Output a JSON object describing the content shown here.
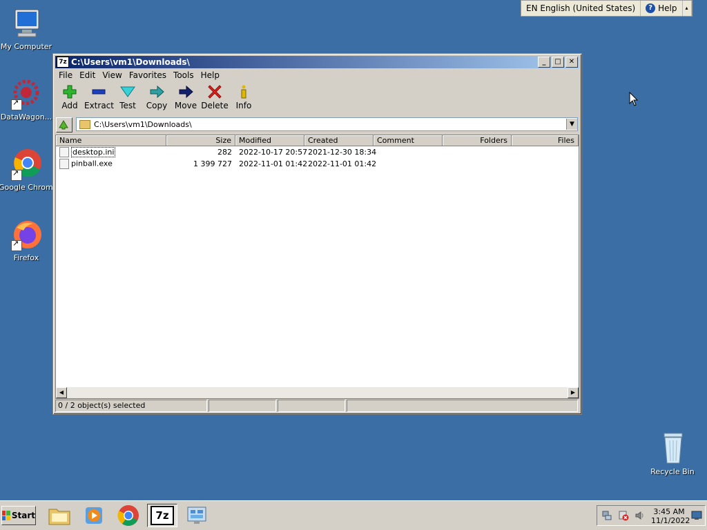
{
  "desktop": {
    "icons": [
      {
        "label": "My Computer"
      },
      {
        "label": "DataWagon..."
      },
      {
        "label": "Google Chrome"
      },
      {
        "label": "Firefox"
      }
    ],
    "recycle_bin": {
      "label": "Recycle Bin"
    }
  },
  "langbar": {
    "language": "EN English (United States)",
    "help": "Help"
  },
  "window": {
    "title": "C:\\Users\\vm1\\Downloads\\",
    "app_icon_text": "7z",
    "menu": [
      "File",
      "Edit",
      "View",
      "Favorites",
      "Tools",
      "Help"
    ],
    "toolbar": [
      "Add",
      "Extract",
      "Test",
      "Copy",
      "Move",
      "Delete",
      "Info"
    ],
    "address": "C:\\Users\\vm1\\Downloads\\",
    "columns": [
      "Name",
      "Size",
      "Modified",
      "Created",
      "Comment",
      "Folders",
      "Files"
    ],
    "files": [
      {
        "name": "desktop.ini",
        "size": "282",
        "modified": "2022-10-17 20:57",
        "created": "2021-12-30 18:34"
      },
      {
        "name": "pinball.exe",
        "size": "1 399 727",
        "modified": "2022-11-01 01:42",
        "created": "2022-11-01 01:42"
      }
    ],
    "status": "0 / 2 object(s) selected"
  },
  "taskbar": {
    "start_label": "Start",
    "apps": [
      "file-explorer",
      "media-player",
      "chrome",
      "7zip",
      "control-panel"
    ],
    "active_app_text": "7z",
    "clock_time": "3:45 AM",
    "clock_date": "11/1/2022"
  },
  "colors": {
    "desktop": "#3a6ea5",
    "titlebar": "#0a246a"
  }
}
